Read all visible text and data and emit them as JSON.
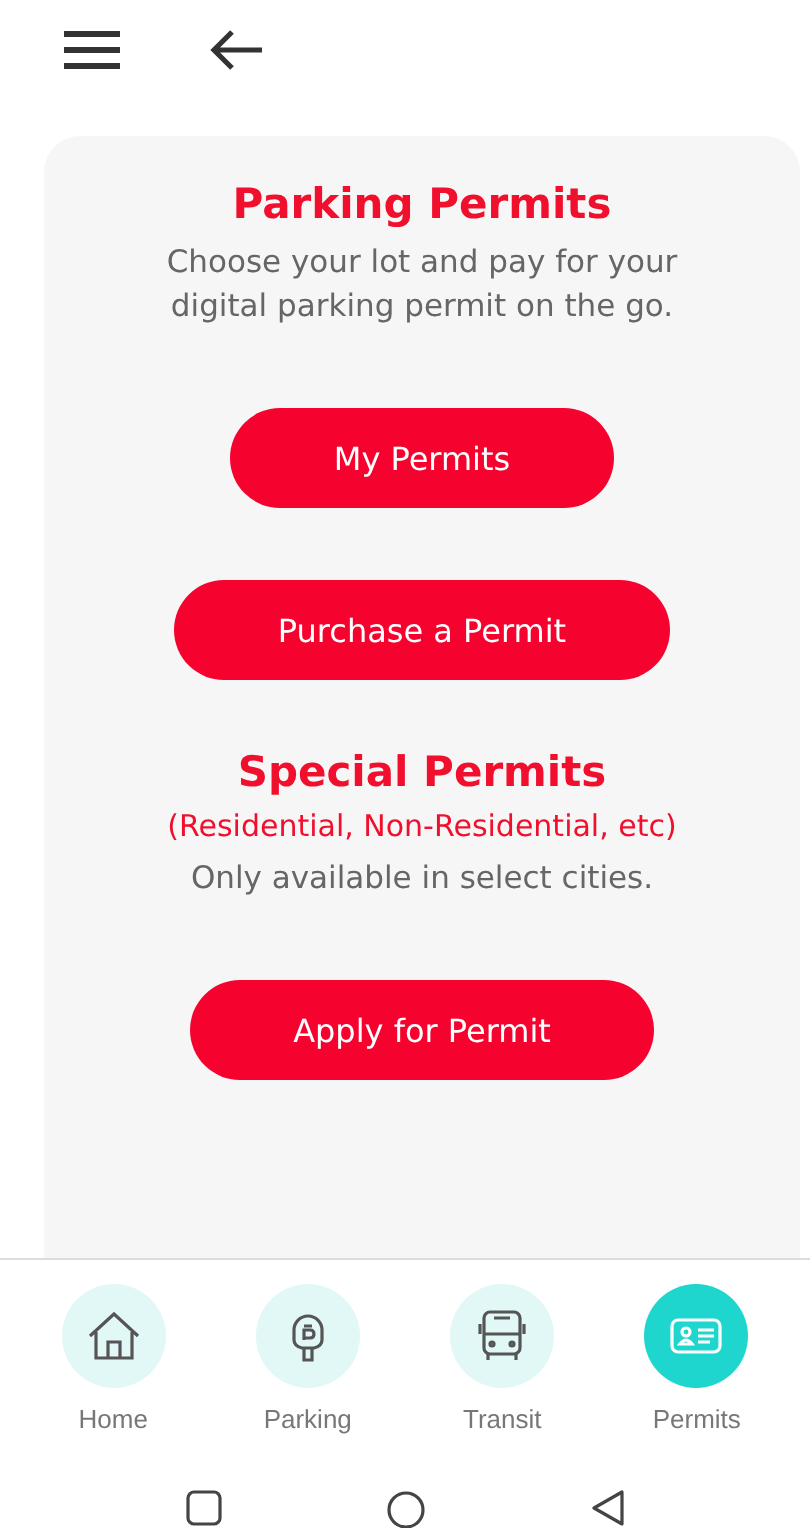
{
  "sections": [
    {
      "title": "Parking Permits",
      "description": "Choose your lot and pay for your digital parking permit on the go.",
      "buttons": [
        "My Permits",
        "Purchase a Permit"
      ]
    },
    {
      "title": "Special Permits",
      "note": "(Residential, Non-Residential, etc)",
      "description": "Only available in select cities.",
      "buttons": [
        "Apply for Permit"
      ]
    }
  ],
  "nav": [
    {
      "label": "Home",
      "selected": false
    },
    {
      "label": "Parking",
      "selected": false
    },
    {
      "label": "Transit",
      "selected": false
    },
    {
      "label": "Permits",
      "selected": true
    }
  ]
}
